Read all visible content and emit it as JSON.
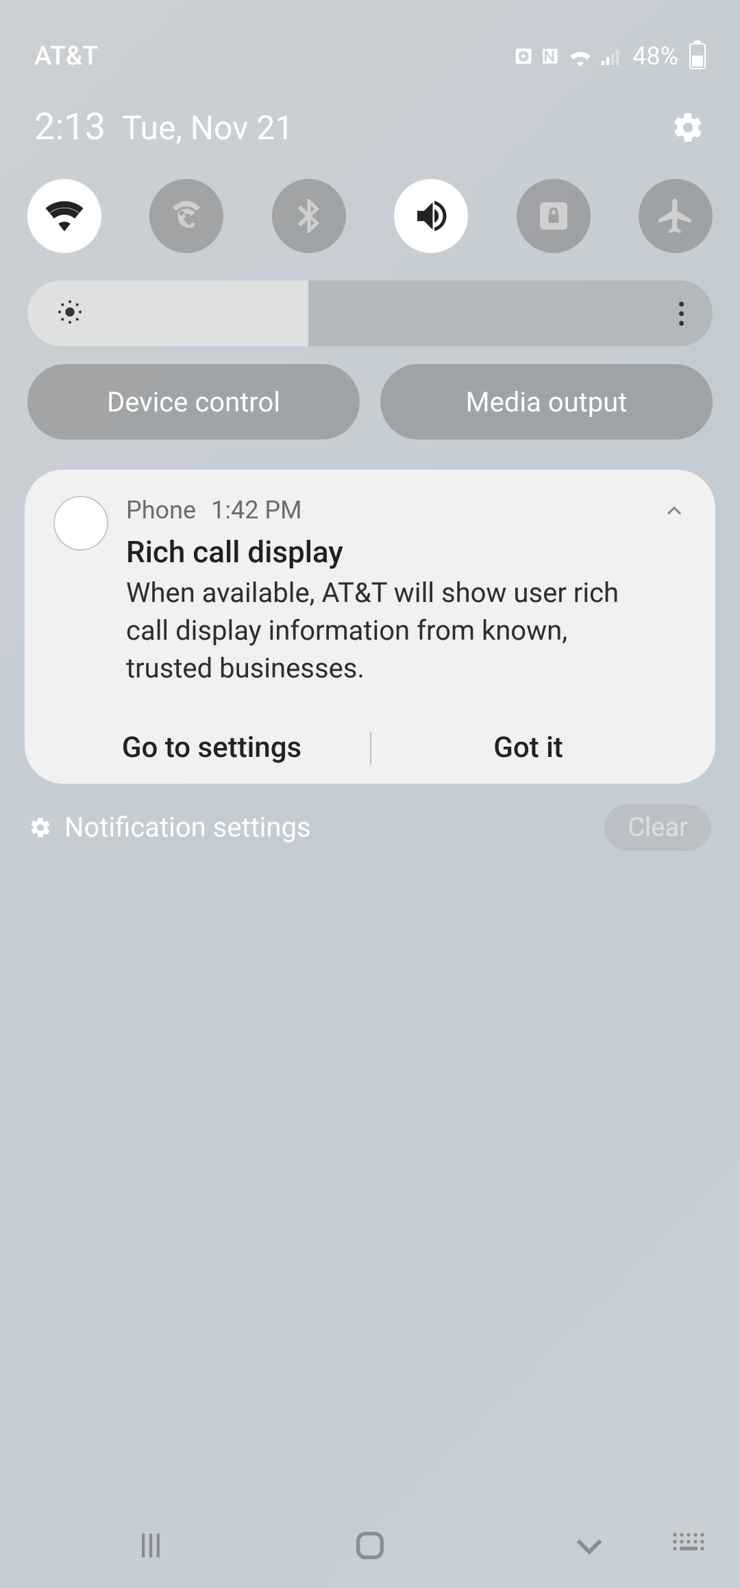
{
  "status": {
    "carrier": "AT&T",
    "battery_text": "48%",
    "battery_pct": 48
  },
  "datetime": {
    "time": "2:13",
    "date": "Tue, Nov 21"
  },
  "quick_toggles": [
    {
      "name": "wifi",
      "active": true
    },
    {
      "name": "wifi-calling",
      "active": false
    },
    {
      "name": "bluetooth",
      "active": false
    },
    {
      "name": "sound",
      "active": true
    },
    {
      "name": "rotation-lock",
      "active": false
    },
    {
      "name": "airplane",
      "active": false
    }
  ],
  "brightness": {
    "percent": 41
  },
  "controls": {
    "device_control_label": "Device control",
    "media_output_label": "Media output"
  },
  "notification": {
    "app": "Phone",
    "time": "1:42 PM",
    "title": "Rich call display",
    "body": "When available, AT&T will show user rich call display information from known, trusted businesses.",
    "action_primary": "Go to settings",
    "action_secondary": "Got it"
  },
  "footer": {
    "settings_label": "Notification settings",
    "clear_label": "Clear"
  }
}
